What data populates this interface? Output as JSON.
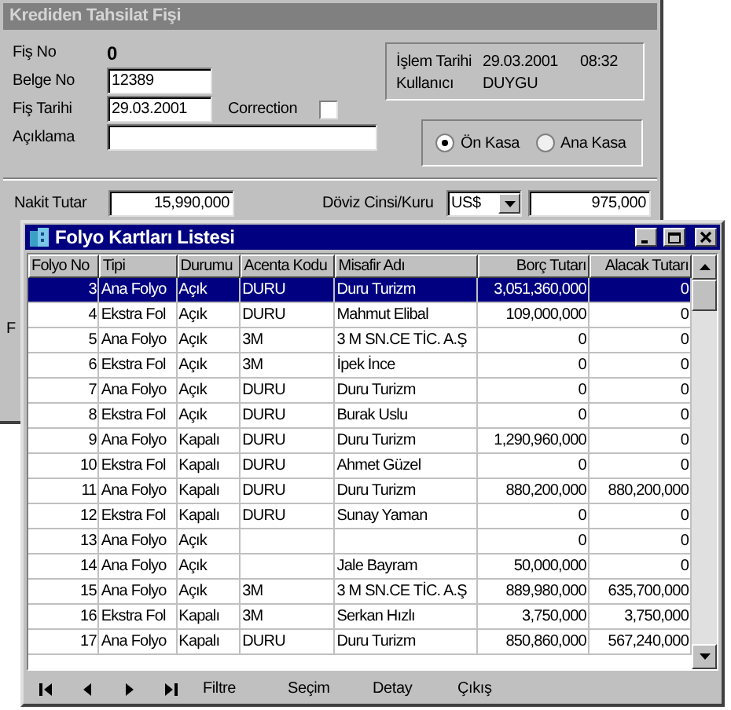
{
  "back_window": {
    "title": "Krediden Tahsilat Fişi",
    "fields": [
      {
        "label": "Fiş No",
        "value": "0",
        "kind": "static"
      },
      {
        "label": "Belge No",
        "value": "12389",
        "kind": "input"
      },
      {
        "label": "Fiş Tarihi",
        "value": "29.03.2001",
        "kind": "input"
      },
      {
        "label": "Açıklama",
        "kind": "wide_input"
      }
    ],
    "correction": {
      "label": "Correction",
      "checked": false
    },
    "info": [
      {
        "label": "İşlem Tarihi",
        "value": "29.03.2001",
        "time": "08:32"
      },
      {
        "label": "Kullanıcı",
        "value": "DUYGU"
      }
    ],
    "kasa": [
      {
        "label": "Ön Kasa",
        "selected": true
      },
      {
        "label": "Ana Kasa",
        "selected": false
      }
    ],
    "nakit": {
      "label": "Nakit Tutar",
      "value": "15,990,000"
    },
    "doviz": {
      "label": "Döviz Cinsi/Kuru",
      "currency": "US$",
      "rate": "975,000"
    },
    "hidden_label": "F"
  },
  "list_window": {
    "title": "Folyo Kartları Listesi",
    "columns": [
      "Folyo No",
      "Tipi",
      "Durumu",
      "Acenta Kodu",
      "Misafir Adı",
      "Borç Tutarı",
      "Alacak Tutarı"
    ],
    "rows": [
      {
        "selected": true,
        "folyo_no": "3",
        "tipi": "Ana Folyo",
        "durumu": "Açık",
        "acenta": "DURU",
        "misafir": "Duru Turizm",
        "borc": "3,051,360,000",
        "alacak": "0"
      },
      {
        "selected": false,
        "folyo_no": "4",
        "tipi": "Ekstra Fol",
        "durumu": "Açık",
        "acenta": "DURU",
        "misafir": "Mahmut Elibal",
        "borc": "109,000,000",
        "alacak": "0"
      },
      {
        "selected": false,
        "folyo_no": "5",
        "tipi": "Ana Folyo",
        "durumu": "Açık",
        "acenta": "3M",
        "misafir": "3 M SN.CE TİC. A.Ş",
        "borc": "0",
        "alacak": "0"
      },
      {
        "selected": false,
        "folyo_no": "6",
        "tipi": "Ekstra Fol",
        "durumu": "Açık",
        "acenta": "3M",
        "misafir": "İpek İnce",
        "borc": "0",
        "alacak": "0"
      },
      {
        "selected": false,
        "folyo_no": "7",
        "tipi": "Ana Folyo",
        "durumu": "Açık",
        "acenta": "DURU",
        "misafir": "Duru Turizm",
        "borc": "0",
        "alacak": "0"
      },
      {
        "selected": false,
        "folyo_no": "8",
        "tipi": "Ekstra Fol",
        "durumu": "Açık",
        "acenta": "DURU",
        "misafir": "Burak Uslu",
        "borc": "0",
        "alacak": "0"
      },
      {
        "selected": false,
        "folyo_no": "9",
        "tipi": "Ana Folyo",
        "durumu": "Kapalı",
        "acenta": "DURU",
        "misafir": "Duru Turizm",
        "borc": "1,290,960,000",
        "alacak": "0"
      },
      {
        "selected": false,
        "folyo_no": "10",
        "tipi": "Ekstra Fol",
        "durumu": "Kapalı",
        "acenta": "DURU",
        "misafir": "Ahmet Güzel",
        "borc": "0",
        "alacak": "0"
      },
      {
        "selected": false,
        "folyo_no": "11",
        "tipi": "Ana Folyo",
        "durumu": "Kapalı",
        "acenta": "DURU",
        "misafir": "Duru Turizm",
        "borc": "880,200,000",
        "alacak": "880,200,000"
      },
      {
        "selected": false,
        "folyo_no": "12",
        "tipi": "Ekstra Fol",
        "durumu": "Kapalı",
        "acenta": "DURU",
        "misafir": "Sunay Yaman",
        "borc": "0",
        "alacak": "0"
      },
      {
        "selected": false,
        "folyo_no": "13",
        "tipi": "Ana Folyo",
        "durumu": "Açık",
        "borc": "0",
        "alacak": "0"
      },
      {
        "selected": false,
        "folyo_no": "14",
        "tipi": "Ana Folyo",
        "durumu": "Açık",
        "misafir": "Jale Bayram",
        "borc": "50,000,000",
        "alacak": "0"
      },
      {
        "selected": false,
        "folyo_no": "15",
        "tipi": "Ana Folyo",
        "durumu": "Açık",
        "acenta": "3M",
        "misafir": "3 M SN.CE TİC. A.Ş",
        "borc": "889,980,000",
        "alacak": "635,700,000"
      },
      {
        "selected": false,
        "folyo_no": "16",
        "tipi": "Ekstra Fol",
        "durumu": "Kapalı",
        "acenta": "3M",
        "misafir": "Serkan Hızlı",
        "borc": "3,750,000",
        "alacak": "3,750,000"
      },
      {
        "selected": false,
        "folyo_no": "17",
        "tipi": "Ana Folyo",
        "durumu": "Kapalı",
        "acenta": "DURU",
        "misafir": "Duru Turizm",
        "borc": "850,860,000",
        "alacak": "567,240,000"
      }
    ],
    "buttons": [
      "Filtre",
      "Seçim",
      "Detay",
      "Çıkış"
    ]
  }
}
